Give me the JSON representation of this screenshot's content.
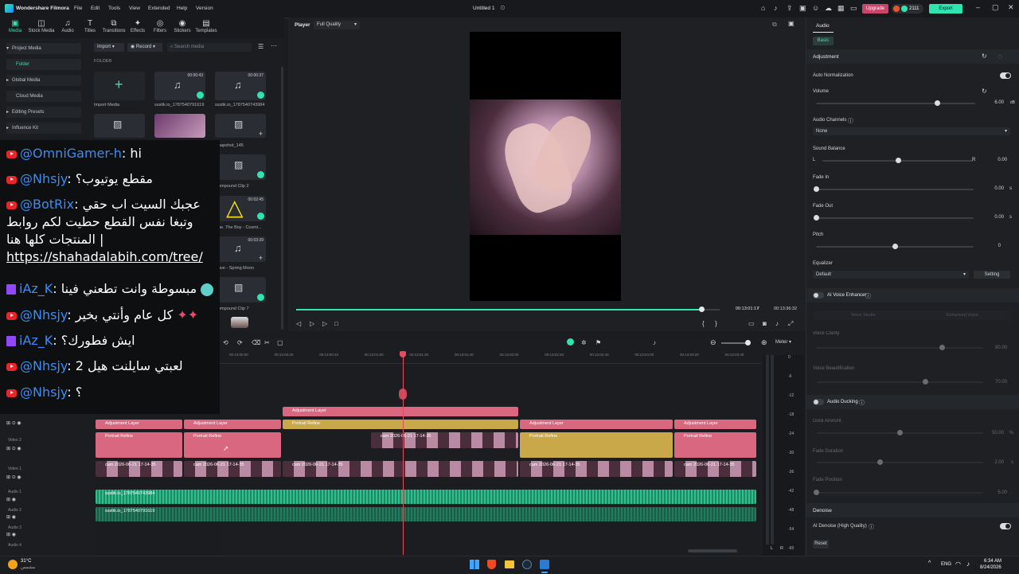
{
  "app": {
    "name": "Wondershare Filmora",
    "menu": [
      "File",
      "Edit",
      "Tools",
      "View",
      "Extended",
      "Help",
      "Version"
    ],
    "project_title": "Untitled 1",
    "upgrade_label": "Upgrade",
    "credits": "2111",
    "export_label": "Export"
  },
  "toolbar": [
    {
      "label": "Media",
      "icon": "media-icon"
    },
    {
      "label": "Stock Media",
      "icon": "stock-media-icon"
    },
    {
      "label": "Audio",
      "icon": "audio-icon"
    },
    {
      "label": "Titles",
      "icon": "titles-icon"
    },
    {
      "label": "Transitions",
      "icon": "transitions-icon"
    },
    {
      "label": "Effects",
      "icon": "effects-icon"
    },
    {
      "label": "Filters",
      "icon": "filters-icon"
    },
    {
      "label": "Stickers",
      "icon": "stickers-icon"
    },
    {
      "label": "Templates",
      "icon": "templates-icon"
    }
  ],
  "leftnav": {
    "items": [
      "Project Media",
      "Folder",
      "Global Media",
      "Cloud Media",
      "Editing Presets",
      "Influence Kit"
    ]
  },
  "media": {
    "import_label": "Import",
    "record_label": "Record",
    "search_placeholder": "Search media",
    "folder_label": "FOLDER",
    "items": [
      {
        "name": "Import Media",
        "duration": ""
      },
      {
        "name": "ssstik.io_1787540791619",
        "duration": "00:00:43"
      },
      {
        "name": "ssstik.io_1787540743984",
        "duration": "00:00:37"
      },
      {
        "name": "napshot_145",
        "duration": ""
      },
      {
        "name": "ompound Clip 2",
        "duration": ""
      },
      {
        "name": "ne. The Boy - Cosmi...",
        "duration": "00:02:45"
      },
      {
        "name": "ave - Spring Moon",
        "duration": "00:03:39"
      },
      {
        "name": "ompound Clip 7",
        "duration": ""
      }
    ]
  },
  "player": {
    "label": "Player",
    "quality": "Full Quality",
    "current_time": "00:13:01:17",
    "total_time": "00:13:36:32",
    "progress": 0.957
  },
  "chat": [
    {
      "platform": "youtube",
      "user": "@OmniGamer-h",
      "text": "hi"
    },
    {
      "platform": "youtube",
      "user": "@Nhsjy",
      "text": "مقطع يوتيوب؟"
    },
    {
      "platform": "youtube",
      "user": "@BotRix",
      "text": "عجبك السيت اب حقي وتبغا نفس القطع حطيت لكم روابط المنتجات كلها هنا |",
      "link": "https://shahadalabih.com/tree/"
    },
    {
      "platform": "twitch",
      "user": "iAz_K",
      "text": "مبسوطة وانت تطعني فينا"
    },
    {
      "platform": "youtube",
      "user": "@Nhsjy",
      "text": "كل عام وأنتي بخير"
    },
    {
      "platform": "twitch",
      "user": "iAz_K",
      "text": "ايش فطورك؟"
    },
    {
      "platform": "youtube",
      "user": "@Nhsjy",
      "text": "لعبتي سايلنت هيل 2"
    },
    {
      "platform": "youtube",
      "user": "@Nhsjy",
      "text": "؟"
    }
  ],
  "timeline": {
    "ruler": [
      "00:13:00:00",
      "00:13:00:20",
      "00:13:00:40",
      "00:13:01:00",
      "00:13:01:20",
      "00:13:01:40",
      "00:13:02:00",
      "00:13:02:20",
      "00:13:02:40",
      "00:13:03:00",
      "00:13:03:20",
      "00:13:03:40"
    ],
    "meter_label": "Meter",
    "meter_scale": [
      "0",
      "-6",
      "-12",
      "-18",
      "-24",
      "-30",
      "-36",
      "-42",
      "-48",
      "-54",
      "-60"
    ],
    "meter_lr": [
      "L",
      "R"
    ],
    "track_labels": [
      "Video 2",
      "Video 1",
      "Audio 1",
      "Audio 2",
      "Audio 3",
      "Audio 4"
    ],
    "clips": {
      "adjustment": "Adjustment Layer",
      "portrait": "Portrait Refine",
      "cam": "cam 2026-06-21 17-14-35",
      "audio1": "ssstik.io_1787540743984",
      "audio2": "ssstik.io_1787540791619"
    }
  },
  "rpanel": {
    "tab": "Audio",
    "subtab": "Basic",
    "adjustment": "Adjustment",
    "auto_normalization": "Auto Normalization",
    "volume": {
      "label": "Volume",
      "value": "6.00",
      "unit": "dB",
      "level": 0.76
    },
    "channels": {
      "label": "Audio Channels",
      "value": "None"
    },
    "balance": {
      "label": "Sound Balance",
      "value": "0.00",
      "l": "L",
      "r": "R",
      "level": 0.5
    },
    "fade_in": {
      "label": "Fade In",
      "value": "0.00",
      "unit": "s",
      "level": 0.0
    },
    "fade_out": {
      "label": "Fade Out",
      "value": "0.00",
      "unit": "s",
      "level": 0.0
    },
    "pitch": {
      "label": "Pitch",
      "value": "0",
      "level": 0.5
    },
    "equalizer": {
      "label": "Equalizer",
      "value": "Default",
      "setting": "Setting"
    },
    "voice_enhancer": "AI Voice Enhancer",
    "voice_tabs": [
      "Voice Studio",
      "Enhanced Voice"
    ],
    "voice_clarity": {
      "label": "Voice Clarity",
      "value": "80.00",
      "level": 0.75
    },
    "voice_beautification": {
      "label": "Voice Beautification",
      "value": "70.00",
      "level": 0.65
    },
    "ducking": "Audio Ducking",
    "duck_amount": {
      "label": "Duck Amount",
      "value": "50.00",
      "unit": "%",
      "level": 0.5
    },
    "fade_duration": {
      "label": "Fade Duration",
      "value": "2.00",
      "unit": "s",
      "level": 0.38
    },
    "fade_position": {
      "label": "Fade Position",
      "value": "5.00",
      "level": 0.0
    },
    "denoise": "Denoise",
    "ai_denoise": "AI Denoise (High Quality)",
    "reset": "Reset"
  },
  "taskbar": {
    "weather_temp": "31°C",
    "weather_desc": "مشمس",
    "lang": "ENG",
    "time": "6:34 AM",
    "date": "8/24/2026"
  },
  "colors": {
    "accent": "#2ee5b2",
    "adjustment": "#d9677f",
    "portrait_gold": "#c9a84a",
    "audio": "#2fbf8c",
    "playhead": "#e84a5f",
    "upgrade": "#c9456a",
    "export": "#2ee5b2"
  }
}
